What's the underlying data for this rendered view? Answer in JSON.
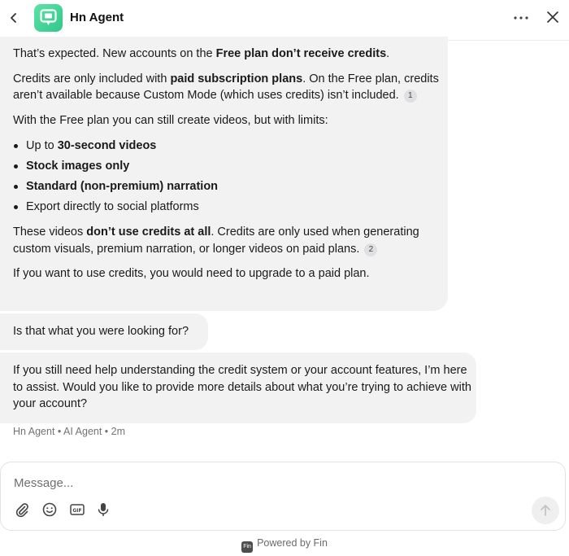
{
  "header": {
    "title": "Hn Agent",
    "back_icon": "chevron-left-icon",
    "more_icon": "more-horizontal-icon",
    "close_icon": "close-icon",
    "brand_color": "#3ccf91"
  },
  "messages": {
    "m1": {
      "p1_a": "That’s expected. New accounts on the ",
      "p1_b": "Free plan don’t receive credits",
      "p1_c": ".",
      "p2_a": "Credits are only included with ",
      "p2_b": "paid subscription plans",
      "p2_c": ". On the Free plan, credits aren’t available because Custom Mode (which uses credits) isn’t included.",
      "cite1": "1",
      "p3": "With the Free plan you can still create videos, but with limits:",
      "li1_a": "Up to ",
      "li1_b": "30-second videos",
      "li2": "Stock images only",
      "li3": "Standard (non-premium) narration",
      "li4": "Export directly to social platforms",
      "p4_a": "These videos ",
      "p4_b": "don’t use credits at all",
      "p4_c": ". Credits are only used when generating custom visuals, premium narration, or longer videos on paid plans.",
      "cite2": "2",
      "p5": "If you want to use credits, you would need to upgrade to a paid plan."
    },
    "m2": "Is that what you were looking for?",
    "m3": "If you still need help understanding the credit system or your account features, I’m here to assist. Would you like to provide more details about what you’re trying to achieve with your account?",
    "meta": "Hn Agent • AI Agent • 2m"
  },
  "composer": {
    "placeholder": "Message...",
    "tools": [
      "attachment-icon",
      "emoji-icon",
      "gif-icon",
      "microphone-icon"
    ],
    "send_icon": "arrow-up-icon"
  },
  "footer": {
    "badge": "Fin",
    "text": "Powered by Fin"
  }
}
